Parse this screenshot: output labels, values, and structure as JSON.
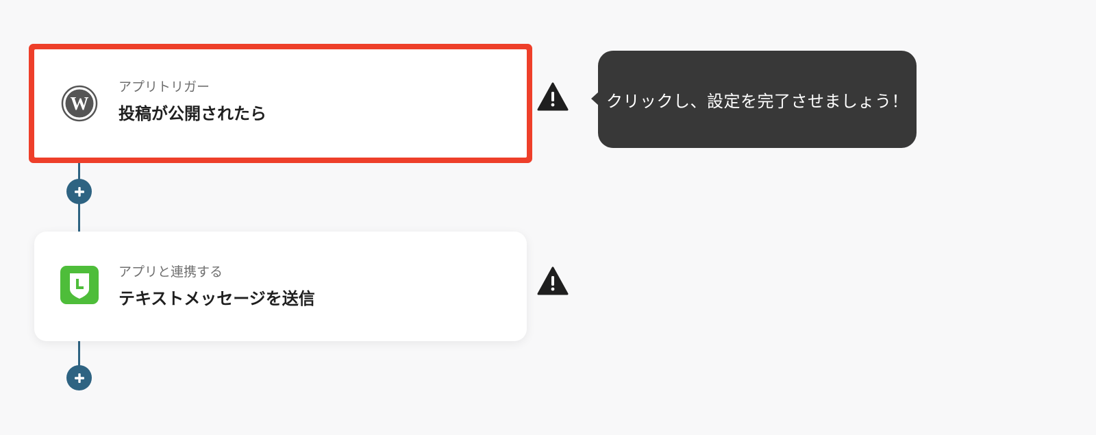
{
  "flow": {
    "steps": [
      {
        "label": "アプリトリガー",
        "title": "投稿が公開されたら",
        "app_icon": "wordpress-icon",
        "highlighted": true,
        "highlight_color": "#ee3f2a"
      },
      {
        "label": "アプリと連携する",
        "title": "テキストメッセージを送信",
        "app_icon": "line-icon",
        "highlighted": false,
        "icon_color": "#4ebd3a"
      }
    ],
    "add_step_icon": "plus-icon",
    "warning_icon": "warning-icon",
    "connector_color": "#2e6382"
  },
  "tooltip": {
    "text": "クリックし、設定を完了させましょう！"
  }
}
